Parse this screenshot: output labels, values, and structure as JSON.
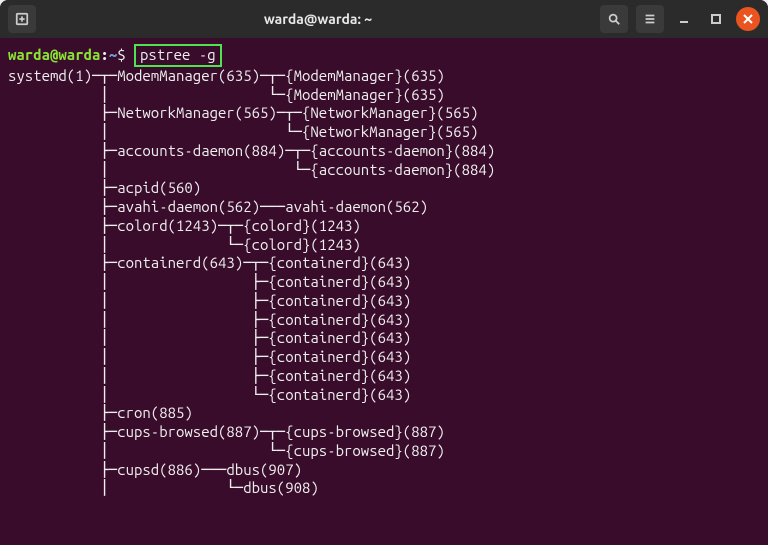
{
  "window": {
    "title": "warda@warda: ~"
  },
  "prompt": {
    "user_host": "warda@warda",
    "colon": ":",
    "path": "~",
    "dollar": "$"
  },
  "command": {
    "text": "pstree -g"
  },
  "tree_output": "systemd(1)─┬─ModemManager(635)─┬─{ModemManager}(635)\n           │                   └─{ModemManager}(635)\n           ├─NetworkManager(565)─┬─{NetworkManager}(565)\n           │                     └─{NetworkManager}(565)\n           ├─accounts-daemon(884)─┬─{accounts-daemon}(884)\n           │                      └─{accounts-daemon}(884)\n           ├─acpid(560)\n           ├─avahi-daemon(562)───avahi-daemon(562)\n           ├─colord(1243)─┬─{colord}(1243)\n           │              └─{colord}(1243)\n           ├─containerd(643)─┬─{containerd}(643)\n           │                 ├─{containerd}(643)\n           │                 ├─{containerd}(643)\n           │                 ├─{containerd}(643)\n           │                 ├─{containerd}(643)\n           │                 ├─{containerd}(643)\n           │                 ├─{containerd}(643)\n           │                 └─{containerd}(643)\n           ├─cron(885)\n           ├─cups-browsed(887)─┬─{cups-browsed}(887)\n           │                   └─{cups-browsed}(887)\n           ├─cupsd(886)───dbus(907)\n           │              └─dbus(908)"
}
